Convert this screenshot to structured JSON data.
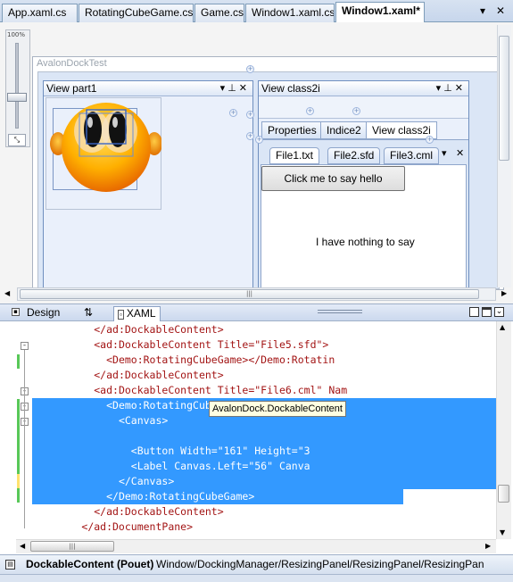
{
  "doc_tabs": {
    "tabs": [
      {
        "label": "App.xaml.cs"
      },
      {
        "label": "RotatingCubeGame.cs"
      },
      {
        "label": "Game.cs"
      },
      {
        "label": "Window1.xaml.cs"
      },
      {
        "label": "Window1.xaml*"
      }
    ],
    "active_index": 4
  },
  "designer": {
    "zoom_label": "100%",
    "window_title": "AvalonDockTest",
    "pane_left": {
      "title": "View part1"
    },
    "pane_right": {
      "title": "View class2i",
      "tabs": [
        {
          "label": "Properties"
        },
        {
          "label": "Indice2"
        },
        {
          "label": "View class2i"
        }
      ],
      "file_tabs": [
        {
          "label": "File1.txt"
        },
        {
          "label": "File2.sfd"
        },
        {
          "label": "File3.cml"
        }
      ],
      "button_label": "Click me to say hello",
      "label_text": "I have nothing to say"
    }
  },
  "split": {
    "design_tab": "Design",
    "swap_icon_label": "⇅",
    "xaml_tab": "XAML"
  },
  "editor": {
    "lines": [
      {
        "indent": "          ",
        "text": "</ad:DockableContent>"
      },
      {
        "indent": "          ",
        "text": "<ad:DockableContent Title=\"File5.sfd\">"
      },
      {
        "indent": "            ",
        "text": "<Demo:RotatingCubeGame></Demo:Rotatin"
      },
      {
        "indent": "          ",
        "text": "</ad:DockableContent>"
      },
      {
        "indent": "          ",
        "text": "<ad:DockableContent Title=\"File6.cml\" Nam"
      },
      {
        "indent": "            ",
        "text": "<Demo:RotatingCubeGame>"
      },
      {
        "indent": "              ",
        "text": "<Canvas>"
      },
      {
        "indent": "",
        "text": ""
      },
      {
        "indent": "                ",
        "text": "<Button Width=\"161\" Height=\"3"
      },
      {
        "indent": "                ",
        "text": "<Label Canvas.Left=\"56\" Canva"
      },
      {
        "indent": "              ",
        "text": "</Canvas>"
      },
      {
        "indent": "            ",
        "text": "</Demo:RotatingCubeGame>"
      },
      {
        "indent": "          ",
        "text": "</ad:DockableContent>"
      },
      {
        "indent": "        ",
        "text": "</ad:DocumentPane>"
      }
    ],
    "tooltip": "AvalonDock.DockableContent"
  },
  "status_bar": {
    "element": "DockableContent (Pouet)",
    "path": "Window/DockingManager/ResizingPanel/ResizingPanel/ResizingPan"
  },
  "colors": {
    "selection": "#3399ff",
    "xml_tag": "#a31515",
    "xml_attr": "#ff0000",
    "xml_value": "#0000ff",
    "pane_border": "#6f8fbf"
  }
}
